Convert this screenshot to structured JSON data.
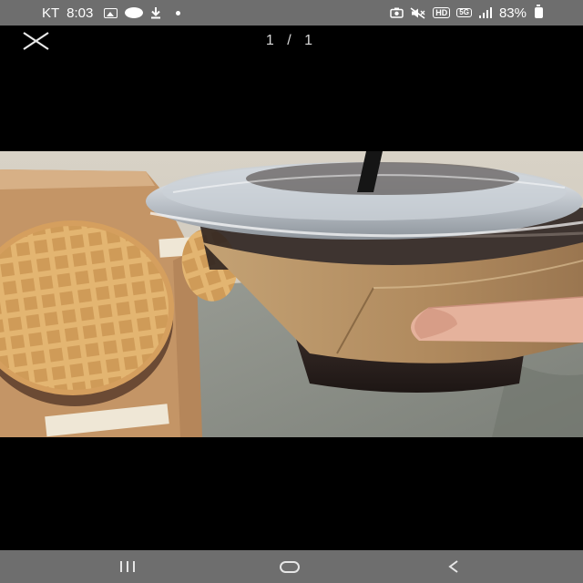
{
  "status_bar": {
    "carrier": "KT",
    "time": "8:03",
    "battery": "83%",
    "icons": [
      "image-icon",
      "talk-icon",
      "download-icon",
      "dot-icon",
      "camera-icon",
      "mute-icon",
      "hd-icon",
      "5g-icon",
      "signal-icon",
      "battery-icon"
    ],
    "hd_label": "HD",
    "network_label": "5G"
  },
  "viewer": {
    "page_indicator": "1 / 1",
    "close_icon": "close-icon"
  },
  "photo": {
    "subject": "photo",
    "colors": {
      "sleeve": "#b08a5e",
      "waffle": "#dcaa66",
      "box": "#c99a6a",
      "shirt": "#8a8e86"
    }
  },
  "nav_bar": {
    "icons": [
      "recents-icon",
      "home-icon",
      "back-icon"
    ]
  }
}
